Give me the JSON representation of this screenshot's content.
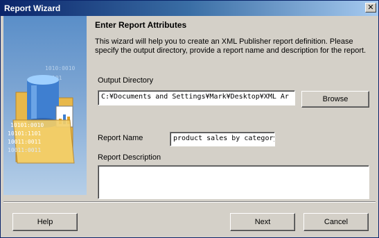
{
  "window": {
    "title": "Report Wizard",
    "close_glyph": "✕"
  },
  "side_panel": {
    "icon": "database-folder-illustration",
    "binary_lines": [
      "10101:0010",
      "10101:1101",
      "10011:0011",
      "10011:0011"
    ]
  },
  "wizard": {
    "heading": "Enter Report Attributes",
    "description": "This wizard will help you to create an XML Publisher report definition. Please specify the output directory, provide a report name and description for the report.",
    "output_directory_label": "Output Directory",
    "output_directory_value": "C:¥Documents and Settings¥Mark¥Desktop¥XML Ar",
    "browse_label": "Browse",
    "report_name_label": "Report Name",
    "report_name_value": "product sales by category",
    "report_description_label": "Report Description",
    "report_description_value": ""
  },
  "footer": {
    "help_label": "Help",
    "next_label": "Next",
    "cancel_label": "Cancel"
  }
}
